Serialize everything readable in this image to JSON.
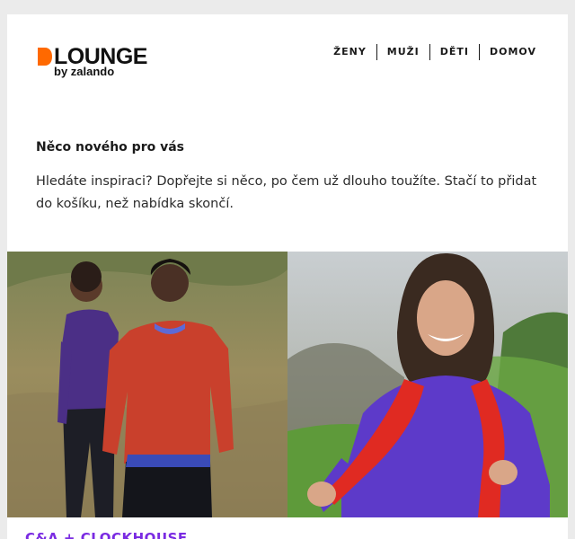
{
  "header": {
    "logo_word": "LOUNGE",
    "logo_sub": "by zalando",
    "nav": [
      {
        "label": "ŽENY"
      },
      {
        "label": "MUŽI"
      },
      {
        "label": "DĚTI"
      },
      {
        "label": "DOMOV"
      }
    ]
  },
  "intro": {
    "title": "Něco nového pro vás",
    "text": "Hledáte inspiraci? Dopřejte si něco, po čem už dlouho toužíte. Stačí to přidat do košíku, než nabídka skončí."
  },
  "campaign": {
    "brand": "C&A + CLOCKHOUSE"
  },
  "colors": {
    "logo_orange": "#ff6900",
    "brand_purple": "#7a2be2",
    "background": "#ebebeb"
  }
}
